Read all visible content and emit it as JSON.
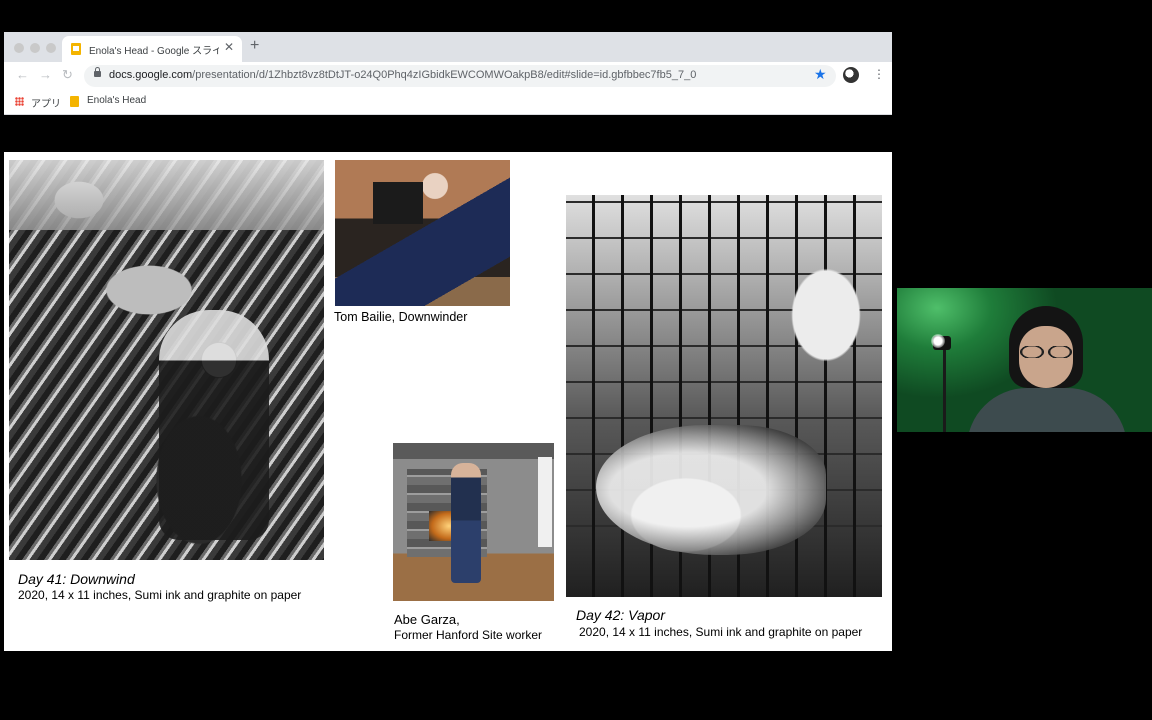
{
  "browser": {
    "tab": {
      "title": "Enola's Head - Google スライド"
    },
    "address": {
      "domain": "docs.google.com",
      "path": "/presentation/d/1Zhbzt8vz8tDtJT-o24Q0Phq4zIGbidkEWCOMWOakpB8/edit#slide=id.gbfbbec7fb5_7_0"
    },
    "bookmarks": {
      "apps_label": "アプリ",
      "bookmark_label": "Enola's Head"
    },
    "icons": {
      "back": "arrow-left",
      "forward": "arrow-right",
      "reload": "reload",
      "star": "star-bookmarked",
      "new_tab": "plus"
    },
    "accent_color": "#1a73e8"
  },
  "slide": {
    "tom": {
      "caption": "Tom Bailie, Downwinder"
    },
    "day41": {
      "title": "Day 41: Downwind",
      "info": "2020, 14 x 11 inches, Sumi ink and graphite on paper"
    },
    "abe": {
      "name": "Abe Garza,",
      "role": "Former Hanford Site worker"
    },
    "day42": {
      "title": "Day 42: Vapor",
      "info": "2020, 14 x 11 inches, Sumi ink and graphite on paper"
    }
  },
  "webcam": {
    "background_color": "#1f7d3a"
  }
}
